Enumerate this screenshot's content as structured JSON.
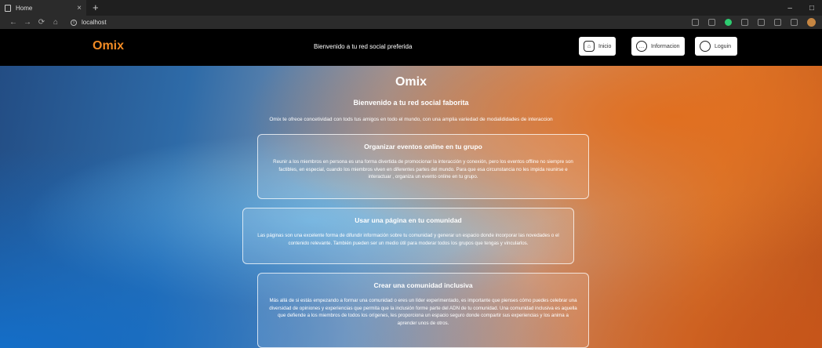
{
  "browser": {
    "tab_title": "Home",
    "tab_close": "×",
    "new_tab": "+",
    "url": "localhost",
    "window_controls": [
      "–",
      "□"
    ]
  },
  "site": {
    "logo": "Omix",
    "tagline": "Bienvenido a tu red social preferida",
    "nav": [
      {
        "label": "Inicio",
        "icon": "home-icon"
      },
      {
        "label": "Informacion",
        "icon": "info-icon"
      },
      {
        "label": "Loguin",
        "icon": "user-icon"
      }
    ]
  },
  "hero": {
    "title": "Omix",
    "subtitle": "Bienvenido a tu red social faborita",
    "intro": "Omix te ofrece concetividad con tods tus amigos en todo el mundo, con una amplia variedad de modalididades de interaccion"
  },
  "cards": [
    {
      "title": "Organizar eventos online en tu grupo",
      "text": "Reunir a los miembros en persona es una forma divertida de promocionar la interacción y conexión, pero los eventos offline no siempre son factibles, en especial, cuando los miembros viven en diferentes partes del mundo. Para que esa circunstancia no les impida reunirse e interactuar , organiza un evento online en tu grupo."
    },
    {
      "title": "Usar una página en tu comunidad",
      "text": "Las páginas son una excelente forma de difundir información sobre tu comunidad y generar un espacio donde incorporar las novedades o el contenido relevante. También pueden ser un medio útil para moderar todos los grupos que tengas y vincularlos."
    },
    {
      "title": "Crear una comunidad inclusiva",
      "text": "Más allá de si estás empezando a formar una comunidad o eres un líder experimentado, es importante que pienses cómo puedes celebrar una diversidad de opiniones y experiencias que permita que la inclusión forme parte del ADN de tu comunidad. Una comunidad inclusiva es aquella que defiende a los miembros de todos los orígenes, les proporciona un espacio seguro donde compartir sus experiencias y los anima a aprender unos de otros."
    }
  ]
}
